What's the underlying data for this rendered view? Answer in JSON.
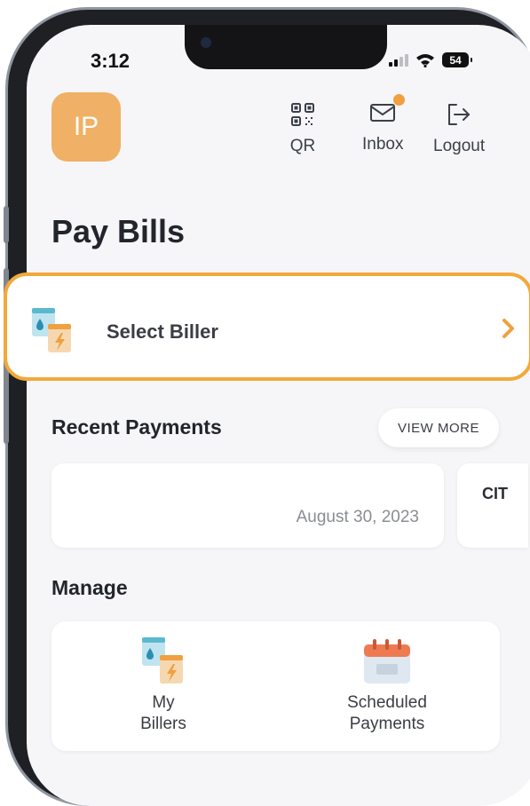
{
  "status_bar": {
    "time": "3:12",
    "battery": "54"
  },
  "header": {
    "avatar_initials": "IP",
    "actions": [
      {
        "label": "QR",
        "icon": "qr-code-icon"
      },
      {
        "label": "Inbox",
        "icon": "mail-icon",
        "has_notification": true
      },
      {
        "label": "Logout",
        "icon": "logout-icon"
      }
    ]
  },
  "page_title": "Pay Bills",
  "select_biller": {
    "label": "Select Biller",
    "icon": "biller-icon"
  },
  "recent_payments": {
    "title": "Recent Payments",
    "view_more_label": "VIEW MORE",
    "items": [
      {
        "date": "August 30, 2023"
      },
      {
        "name": "CIT"
      }
    ]
  },
  "manage": {
    "title": "Manage",
    "items": [
      {
        "line1": "My",
        "line2": "Billers",
        "icon": "biller-icon"
      },
      {
        "line1": "Scheduled",
        "line2": "Payments",
        "icon": "calendar-icon"
      }
    ]
  },
  "colors": {
    "accent": "#f2a93b",
    "avatar_bg": "#f0b065",
    "notification_dot": "#f0a040"
  }
}
